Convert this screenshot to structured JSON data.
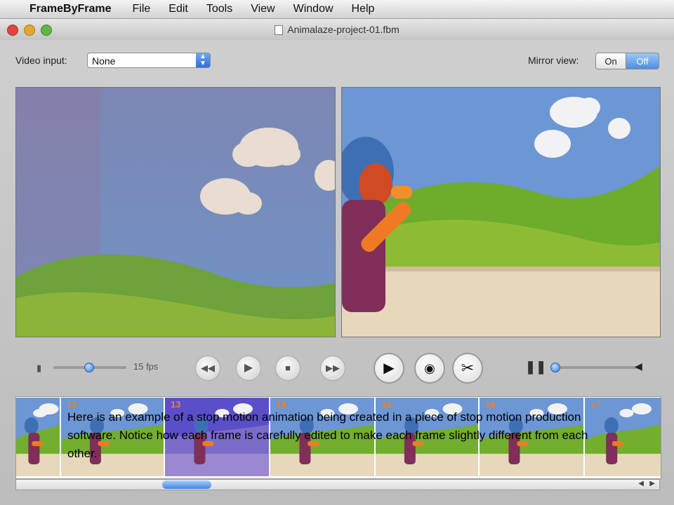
{
  "menubar": {
    "app_name": "FrameByFrame",
    "items": [
      "File",
      "Edit",
      "Tools",
      "View",
      "Window",
      "Help"
    ]
  },
  "window": {
    "title": "Animalaze-project-01.fbm",
    "video_input_label": "Video input:",
    "video_input_value": "None",
    "mirror_view_label": "Mirror view:",
    "mirror_on": "On",
    "mirror_off": "Off",
    "fps_label": "15 fps"
  },
  "filmstrip": {
    "frame_numbers": [
      "",
      "12",
      "13",
      "14",
      "15",
      "16",
      "17"
    ]
  },
  "caption": "Here is an example of a stop motion animation being created in a piece of stop motion production software. Notice how each frame is carefully edited to make each frame slightly different from each other.",
  "colors": {
    "close": "#e0443e",
    "minimize": "#e3a72f",
    "zoom": "#5fb545",
    "selected_frame": "#5a4fc8",
    "frame_number": "#f08020"
  }
}
